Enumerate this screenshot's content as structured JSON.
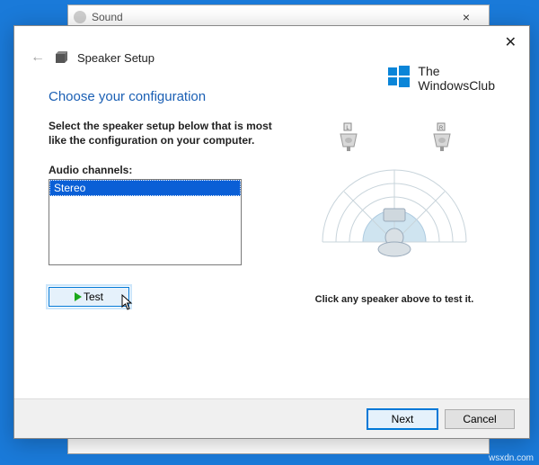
{
  "background_window": {
    "title": "Sound"
  },
  "wizard": {
    "title": "Speaker Setup",
    "heading": "Choose your configuration",
    "instruction": "Select the speaker setup below that is most like the configuration on your computer.",
    "channels_label": "Audio channels:",
    "channels": [
      "Stereo"
    ],
    "test_label": "Test",
    "hint": "Click any speaker above to test it.",
    "next_label": "Next",
    "cancel_label": "Cancel",
    "speakers": {
      "left": "L",
      "right": "R"
    }
  },
  "branding": {
    "line1": "The",
    "line2": "WindowsClub"
  },
  "watermark": "wsxdn.com"
}
